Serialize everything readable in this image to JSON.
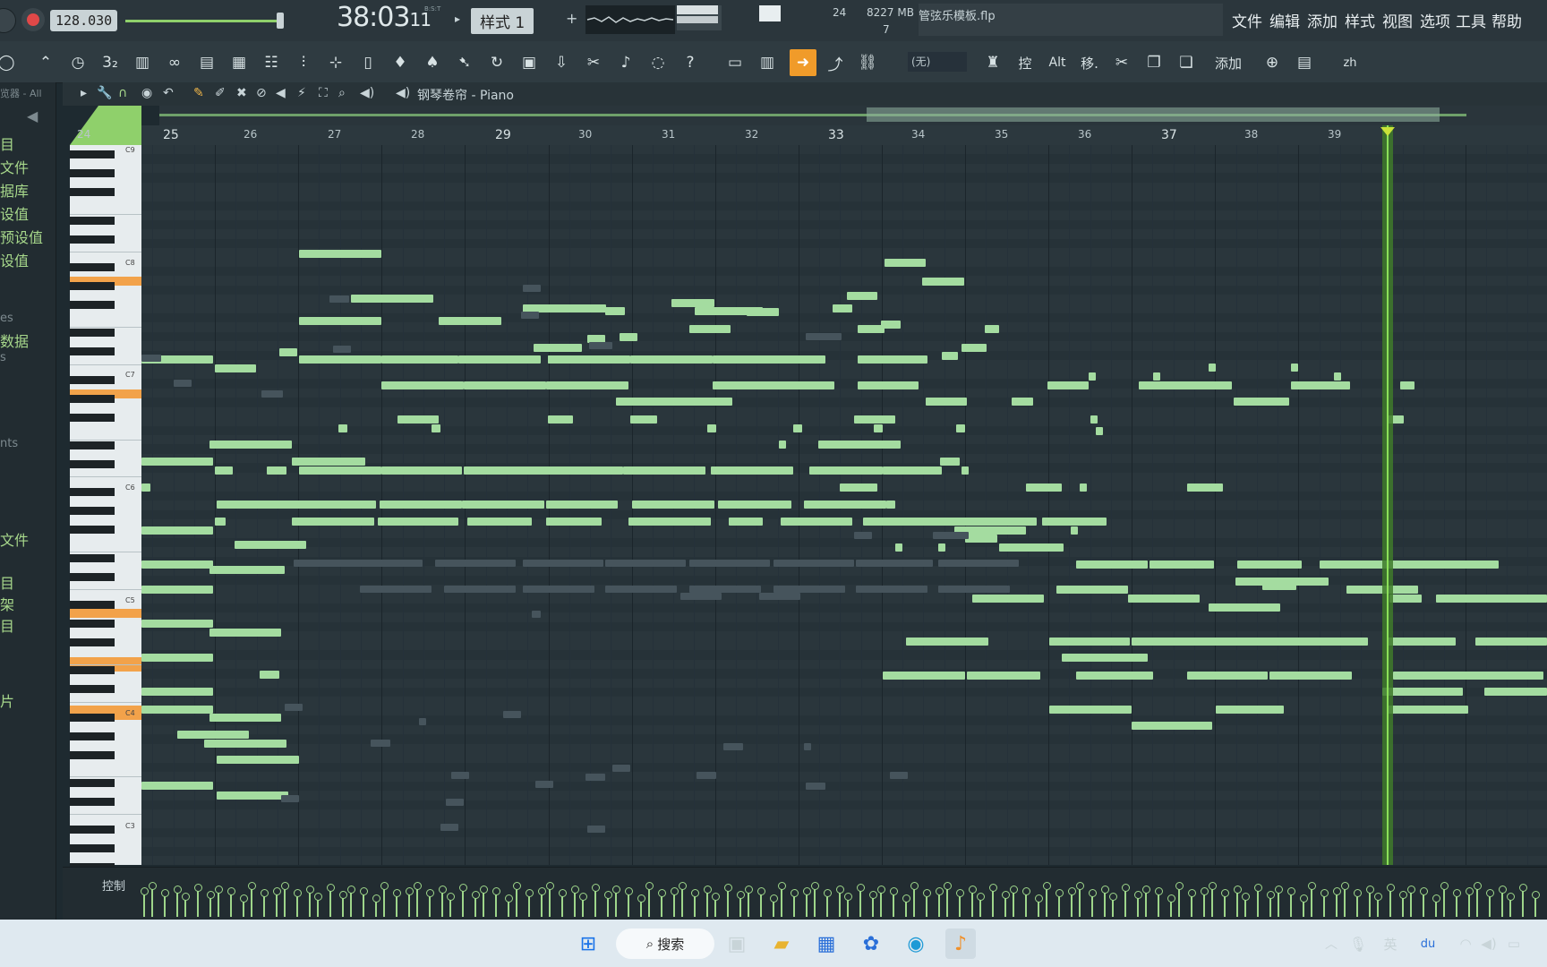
{
  "topbar": {
    "tempo": "128.030",
    "time_main": "38:03",
    "time_sub": "11",
    "time_unit": "B:S:T",
    "pattern": "样式 1",
    "pattern_plus": "+",
    "cpu": "24",
    "memory": "8227 MB",
    "polyphony": "7",
    "project_file": "管弦乐模板.flp"
  },
  "menu": [
    "文件",
    "编辑",
    "添加",
    "样式",
    "视图",
    "选项",
    "工具",
    "帮助"
  ],
  "toolbar": {
    "no_value": "(无)",
    "ctrl_label": "控",
    "alt_label": "Alt",
    "move_label": "移.",
    "add_label": "添加",
    "lang": "zh"
  },
  "pianoroll": {
    "title": "钢琴卷帘 - Piano",
    "browser_label": "览器 - All",
    "control_label": "控制"
  },
  "sidebar": {
    "items": [
      "目",
      "文件",
      "据库",
      "设值",
      "预设值",
      "设值",
      "es",
      "数据",
      "s",
      "nts",
      "文件",
      "目",
      "架",
      "目",
      "片"
    ]
  },
  "ruler": {
    "bars": [
      "24",
      "25",
      "26",
      "27",
      "28",
      "29",
      "30",
      "31",
      "32",
      "33",
      "34",
      "35",
      "36",
      "37",
      "38",
      "39"
    ],
    "big_bars": [
      "25",
      "29",
      "33",
      "37"
    ]
  },
  "keyboard": {
    "octaves": [
      "C9",
      "C8",
      "C7",
      "C6",
      "C5",
      "C4",
      "C3"
    ]
  },
  "taskbar": {
    "search": "搜索",
    "ime": "英",
    "du": "du"
  },
  "colors": {
    "note": "#a4dca0",
    "playhead": "#8ce05a",
    "accent": "#f09b2a"
  }
}
